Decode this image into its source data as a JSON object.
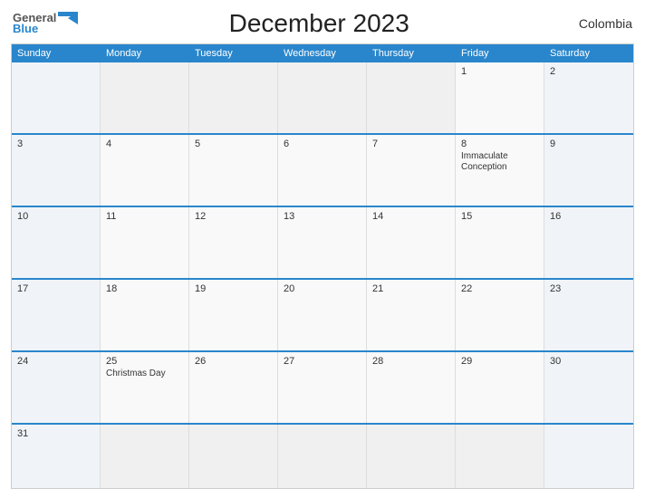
{
  "header": {
    "logo_general": "General",
    "logo_blue": "Blue",
    "title": "December 2023",
    "country": "Colombia"
  },
  "day_headers": [
    "Sunday",
    "Monday",
    "Tuesday",
    "Wednesday",
    "Thursday",
    "Friday",
    "Saturday"
  ],
  "weeks": [
    [
      {
        "day": "",
        "empty": true
      },
      {
        "day": "",
        "empty": true
      },
      {
        "day": "",
        "empty": true
      },
      {
        "day": "",
        "empty": true
      },
      {
        "day": "",
        "empty": true
      },
      {
        "day": "1",
        "holiday": ""
      },
      {
        "day": "2",
        "holiday": ""
      }
    ],
    [
      {
        "day": "3",
        "holiday": ""
      },
      {
        "day": "4",
        "holiday": ""
      },
      {
        "day": "5",
        "holiday": ""
      },
      {
        "day": "6",
        "holiday": ""
      },
      {
        "day": "7",
        "holiday": ""
      },
      {
        "day": "8",
        "holiday": "Immaculate\nConception"
      },
      {
        "day": "9",
        "holiday": ""
      }
    ],
    [
      {
        "day": "10",
        "holiday": ""
      },
      {
        "day": "11",
        "holiday": ""
      },
      {
        "day": "12",
        "holiday": ""
      },
      {
        "day": "13",
        "holiday": ""
      },
      {
        "day": "14",
        "holiday": ""
      },
      {
        "day": "15",
        "holiday": ""
      },
      {
        "day": "16",
        "holiday": ""
      }
    ],
    [
      {
        "day": "17",
        "holiday": ""
      },
      {
        "day": "18",
        "holiday": ""
      },
      {
        "day": "19",
        "holiday": ""
      },
      {
        "day": "20",
        "holiday": ""
      },
      {
        "day": "21",
        "holiday": ""
      },
      {
        "day": "22",
        "holiday": ""
      },
      {
        "day": "23",
        "holiday": ""
      }
    ],
    [
      {
        "day": "24",
        "holiday": ""
      },
      {
        "day": "25",
        "holiday": "Christmas Day"
      },
      {
        "day": "26",
        "holiday": ""
      },
      {
        "day": "27",
        "holiday": ""
      },
      {
        "day": "28",
        "holiday": ""
      },
      {
        "day": "29",
        "holiday": ""
      },
      {
        "day": "30",
        "holiday": ""
      }
    ],
    [
      {
        "day": "31",
        "holiday": ""
      },
      {
        "day": "",
        "empty": true
      },
      {
        "day": "",
        "empty": true
      },
      {
        "day": "",
        "empty": true
      },
      {
        "day": "",
        "empty": true
      },
      {
        "day": "",
        "empty": true
      },
      {
        "day": "",
        "empty": true
      }
    ]
  ],
  "colors": {
    "header_bg": "#2986cc",
    "accent": "#2986cc"
  }
}
